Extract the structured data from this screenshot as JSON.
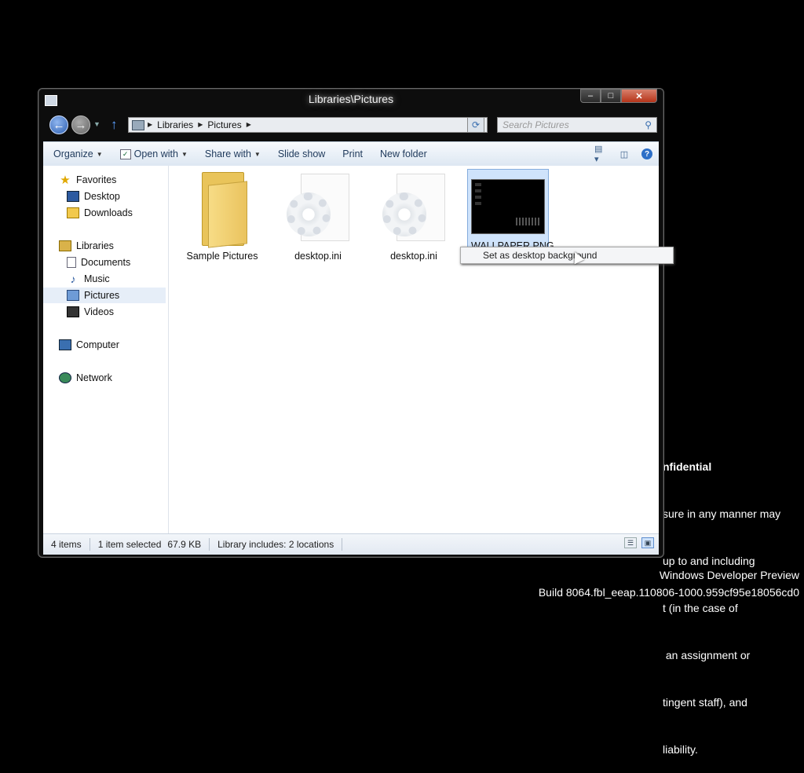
{
  "window": {
    "title": "Libraries\\Pictures",
    "caption": {
      "minimize": "–",
      "maximize": "□",
      "close": "✕"
    }
  },
  "navbar": {
    "back": "←",
    "forward": "→",
    "up": "↑",
    "breadcrumbs": [
      "Libraries",
      "Pictures"
    ],
    "search_placeholder": "Search Pictures"
  },
  "toolbar": {
    "organize": "Organize",
    "open_with": "Open with",
    "share_with": "Share with",
    "slide_show": "Slide show",
    "print": "Print",
    "new_folder": "New folder",
    "help": "?"
  },
  "nav_pane": {
    "favorites": "Favorites",
    "desktop": "Desktop",
    "downloads": "Downloads",
    "libraries": "Libraries",
    "documents": "Documents",
    "music": "Music",
    "pictures": "Pictures",
    "videos": "Videos",
    "computer": "Computer",
    "network": "Network"
  },
  "files": [
    {
      "name": "Sample Pictures",
      "icon": "folder-icon"
    },
    {
      "name": "desktop.ini",
      "icon": "settings-file-icon"
    },
    {
      "name": "desktop.ini",
      "icon": "settings-file-icon"
    },
    {
      "name": "WALLPAPER.PNG",
      "icon": "image-thumbnail"
    }
  ],
  "tooltip": "Set as desktop background",
  "status": {
    "items": "4 items",
    "selected": "1 item selected",
    "size": "67.9 KB",
    "library": "Library includes: 2 locations"
  },
  "desktop": {
    "confidential_title": "nfidential",
    "confidential_lines": [
      "sure in any manner may",
      "up to and including",
      "t (in the case of",
      " an assignment or",
      "tingent staff), and",
      "liability."
    ],
    "watermark_line1": "Windows Developer Preview",
    "watermark_line2": "Build 8064.fbl_eeap.110806-1000.959cf95e18056cd0"
  },
  "colors": {
    "accent": "#2d6fc7",
    "selection": "#cfe3fb"
  }
}
